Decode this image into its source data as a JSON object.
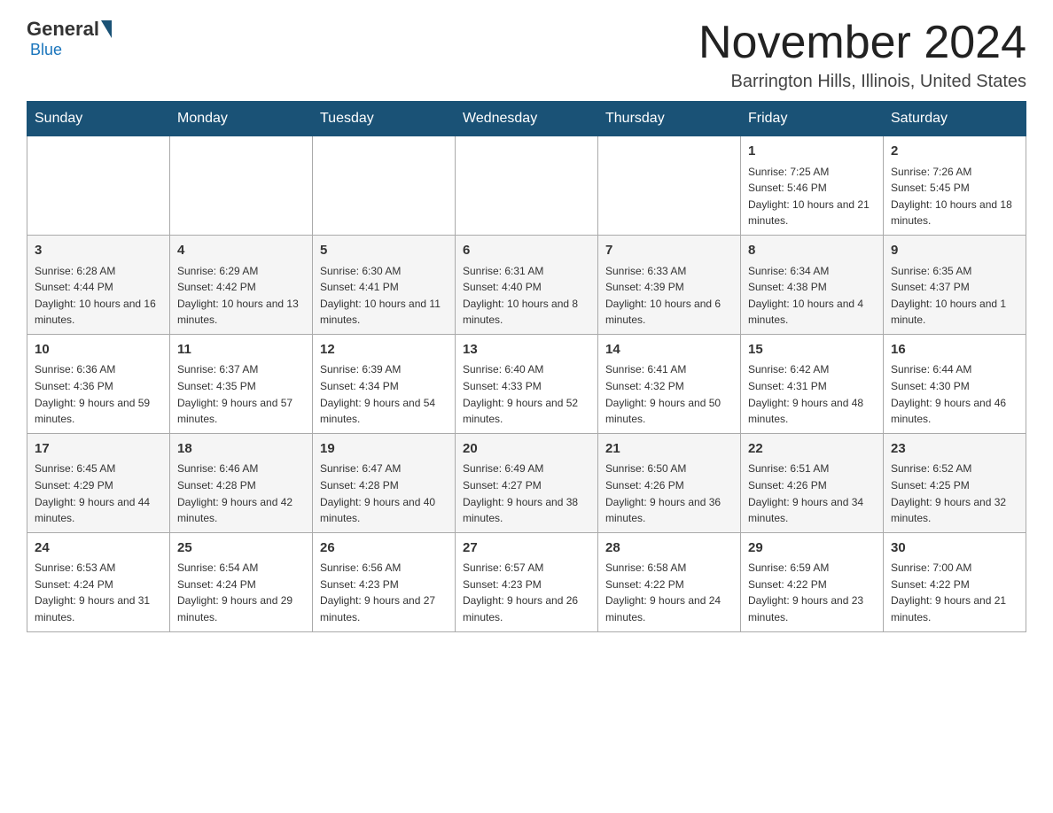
{
  "header": {
    "logo_general": "General",
    "logo_blue": "Blue",
    "month_title": "November 2024",
    "location": "Barrington Hills, Illinois, United States"
  },
  "weekdays": [
    "Sunday",
    "Monday",
    "Tuesday",
    "Wednesday",
    "Thursday",
    "Friday",
    "Saturday"
  ],
  "weeks": [
    [
      {
        "day": "",
        "sunrise": "",
        "sunset": "",
        "daylight": ""
      },
      {
        "day": "",
        "sunrise": "",
        "sunset": "",
        "daylight": ""
      },
      {
        "day": "",
        "sunrise": "",
        "sunset": "",
        "daylight": ""
      },
      {
        "day": "",
        "sunrise": "",
        "sunset": "",
        "daylight": ""
      },
      {
        "day": "",
        "sunrise": "",
        "sunset": "",
        "daylight": ""
      },
      {
        "day": "1",
        "sunrise": "Sunrise: 7:25 AM",
        "sunset": "Sunset: 5:46 PM",
        "daylight": "Daylight: 10 hours and 21 minutes."
      },
      {
        "day": "2",
        "sunrise": "Sunrise: 7:26 AM",
        "sunset": "Sunset: 5:45 PM",
        "daylight": "Daylight: 10 hours and 18 minutes."
      }
    ],
    [
      {
        "day": "3",
        "sunrise": "Sunrise: 6:28 AM",
        "sunset": "Sunset: 4:44 PM",
        "daylight": "Daylight: 10 hours and 16 minutes."
      },
      {
        "day": "4",
        "sunrise": "Sunrise: 6:29 AM",
        "sunset": "Sunset: 4:42 PM",
        "daylight": "Daylight: 10 hours and 13 minutes."
      },
      {
        "day": "5",
        "sunrise": "Sunrise: 6:30 AM",
        "sunset": "Sunset: 4:41 PM",
        "daylight": "Daylight: 10 hours and 11 minutes."
      },
      {
        "day": "6",
        "sunrise": "Sunrise: 6:31 AM",
        "sunset": "Sunset: 4:40 PM",
        "daylight": "Daylight: 10 hours and 8 minutes."
      },
      {
        "day": "7",
        "sunrise": "Sunrise: 6:33 AM",
        "sunset": "Sunset: 4:39 PM",
        "daylight": "Daylight: 10 hours and 6 minutes."
      },
      {
        "day": "8",
        "sunrise": "Sunrise: 6:34 AM",
        "sunset": "Sunset: 4:38 PM",
        "daylight": "Daylight: 10 hours and 4 minutes."
      },
      {
        "day": "9",
        "sunrise": "Sunrise: 6:35 AM",
        "sunset": "Sunset: 4:37 PM",
        "daylight": "Daylight: 10 hours and 1 minute."
      }
    ],
    [
      {
        "day": "10",
        "sunrise": "Sunrise: 6:36 AM",
        "sunset": "Sunset: 4:36 PM",
        "daylight": "Daylight: 9 hours and 59 minutes."
      },
      {
        "day": "11",
        "sunrise": "Sunrise: 6:37 AM",
        "sunset": "Sunset: 4:35 PM",
        "daylight": "Daylight: 9 hours and 57 minutes."
      },
      {
        "day": "12",
        "sunrise": "Sunrise: 6:39 AM",
        "sunset": "Sunset: 4:34 PM",
        "daylight": "Daylight: 9 hours and 54 minutes."
      },
      {
        "day": "13",
        "sunrise": "Sunrise: 6:40 AM",
        "sunset": "Sunset: 4:33 PM",
        "daylight": "Daylight: 9 hours and 52 minutes."
      },
      {
        "day": "14",
        "sunrise": "Sunrise: 6:41 AM",
        "sunset": "Sunset: 4:32 PM",
        "daylight": "Daylight: 9 hours and 50 minutes."
      },
      {
        "day": "15",
        "sunrise": "Sunrise: 6:42 AM",
        "sunset": "Sunset: 4:31 PM",
        "daylight": "Daylight: 9 hours and 48 minutes."
      },
      {
        "day": "16",
        "sunrise": "Sunrise: 6:44 AM",
        "sunset": "Sunset: 4:30 PM",
        "daylight": "Daylight: 9 hours and 46 minutes."
      }
    ],
    [
      {
        "day": "17",
        "sunrise": "Sunrise: 6:45 AM",
        "sunset": "Sunset: 4:29 PM",
        "daylight": "Daylight: 9 hours and 44 minutes."
      },
      {
        "day": "18",
        "sunrise": "Sunrise: 6:46 AM",
        "sunset": "Sunset: 4:28 PM",
        "daylight": "Daylight: 9 hours and 42 minutes."
      },
      {
        "day": "19",
        "sunrise": "Sunrise: 6:47 AM",
        "sunset": "Sunset: 4:28 PM",
        "daylight": "Daylight: 9 hours and 40 minutes."
      },
      {
        "day": "20",
        "sunrise": "Sunrise: 6:49 AM",
        "sunset": "Sunset: 4:27 PM",
        "daylight": "Daylight: 9 hours and 38 minutes."
      },
      {
        "day": "21",
        "sunrise": "Sunrise: 6:50 AM",
        "sunset": "Sunset: 4:26 PM",
        "daylight": "Daylight: 9 hours and 36 minutes."
      },
      {
        "day": "22",
        "sunrise": "Sunrise: 6:51 AM",
        "sunset": "Sunset: 4:26 PM",
        "daylight": "Daylight: 9 hours and 34 minutes."
      },
      {
        "day": "23",
        "sunrise": "Sunrise: 6:52 AM",
        "sunset": "Sunset: 4:25 PM",
        "daylight": "Daylight: 9 hours and 32 minutes."
      }
    ],
    [
      {
        "day": "24",
        "sunrise": "Sunrise: 6:53 AM",
        "sunset": "Sunset: 4:24 PM",
        "daylight": "Daylight: 9 hours and 31 minutes."
      },
      {
        "day": "25",
        "sunrise": "Sunrise: 6:54 AM",
        "sunset": "Sunset: 4:24 PM",
        "daylight": "Daylight: 9 hours and 29 minutes."
      },
      {
        "day": "26",
        "sunrise": "Sunrise: 6:56 AM",
        "sunset": "Sunset: 4:23 PM",
        "daylight": "Daylight: 9 hours and 27 minutes."
      },
      {
        "day": "27",
        "sunrise": "Sunrise: 6:57 AM",
        "sunset": "Sunset: 4:23 PM",
        "daylight": "Daylight: 9 hours and 26 minutes."
      },
      {
        "day": "28",
        "sunrise": "Sunrise: 6:58 AM",
        "sunset": "Sunset: 4:22 PM",
        "daylight": "Daylight: 9 hours and 24 minutes."
      },
      {
        "day": "29",
        "sunrise": "Sunrise: 6:59 AM",
        "sunset": "Sunset: 4:22 PM",
        "daylight": "Daylight: 9 hours and 23 minutes."
      },
      {
        "day": "30",
        "sunrise": "Sunrise: 7:00 AM",
        "sunset": "Sunset: 4:22 PM",
        "daylight": "Daylight: 9 hours and 21 minutes."
      }
    ]
  ]
}
